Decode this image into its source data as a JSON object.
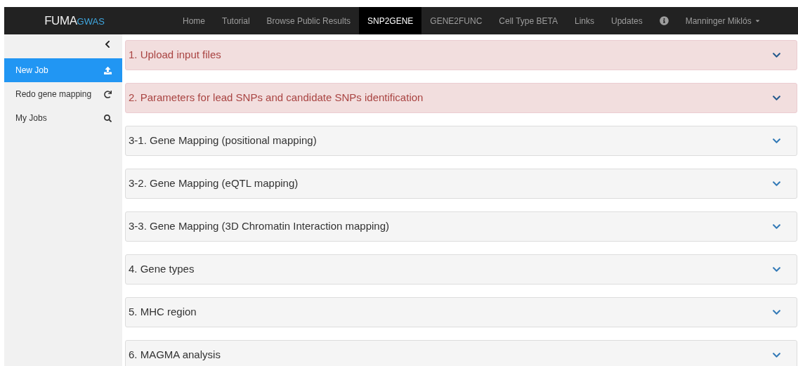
{
  "logo": {
    "primary": "FUMA",
    "accent": "GWAS"
  },
  "nav": [
    {
      "label": "Home",
      "selected": false
    },
    {
      "label": "Tutorial",
      "selected": false
    },
    {
      "label": "Browse Public Results",
      "selected": false
    },
    {
      "label": "SNP2GENE",
      "selected": true
    },
    {
      "label": "GENE2FUNC",
      "selected": false
    },
    {
      "label": "Cell Type BETA",
      "selected": false
    },
    {
      "label": "Links",
      "selected": false
    },
    {
      "label": "Updates",
      "selected": false
    }
  ],
  "user": {
    "name": "Manninger Miklós"
  },
  "sidebar": {
    "items": [
      {
        "label": "New Job",
        "kind": "upload",
        "selected": true
      },
      {
        "label": "Redo gene mapping",
        "kind": "refresh",
        "selected": false
      },
      {
        "label": "My Jobs",
        "kind": "search",
        "selected": false
      }
    ]
  },
  "panels": [
    {
      "title": "1. Upload input files",
      "invalid": true
    },
    {
      "title": "2. Parameters for lead SNPs and candidate SNPs identification",
      "invalid": true
    },
    {
      "title": "3-1. Gene Mapping (positional mapping)",
      "invalid": false
    },
    {
      "title": "3-2. Gene Mapping (eQTL mapping)",
      "invalid": false
    },
    {
      "title": "3-3. Gene Mapping (3D Chromatin Interaction mapping)",
      "invalid": false
    },
    {
      "title": "4. Gene types",
      "invalid": false
    },
    {
      "title": "5. MHC region",
      "invalid": false
    },
    {
      "title": "6. MAGMA analysis",
      "invalid": false
    }
  ]
}
